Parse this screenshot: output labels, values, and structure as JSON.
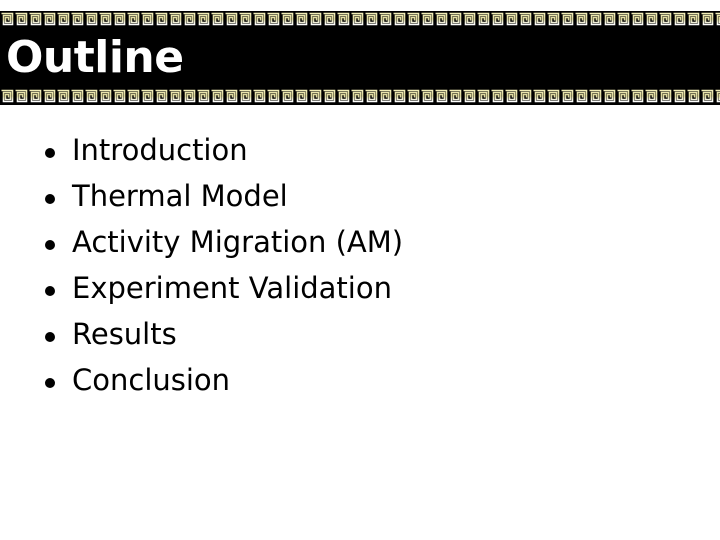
{
  "slide": {
    "title": "Outline",
    "header_background": "#000000",
    "border_pattern": "greek-key",
    "border_colors": [
      "#e9e4a8",
      "#ffffff"
    ]
  },
  "bullets": [
    {
      "label": "Introduction"
    },
    {
      "label": "Thermal Model"
    },
    {
      "label": "Activity Migration (AM)"
    },
    {
      "label": "Experiment Validation"
    },
    {
      "label": "Results"
    },
    {
      "label": "Conclusion"
    }
  ]
}
